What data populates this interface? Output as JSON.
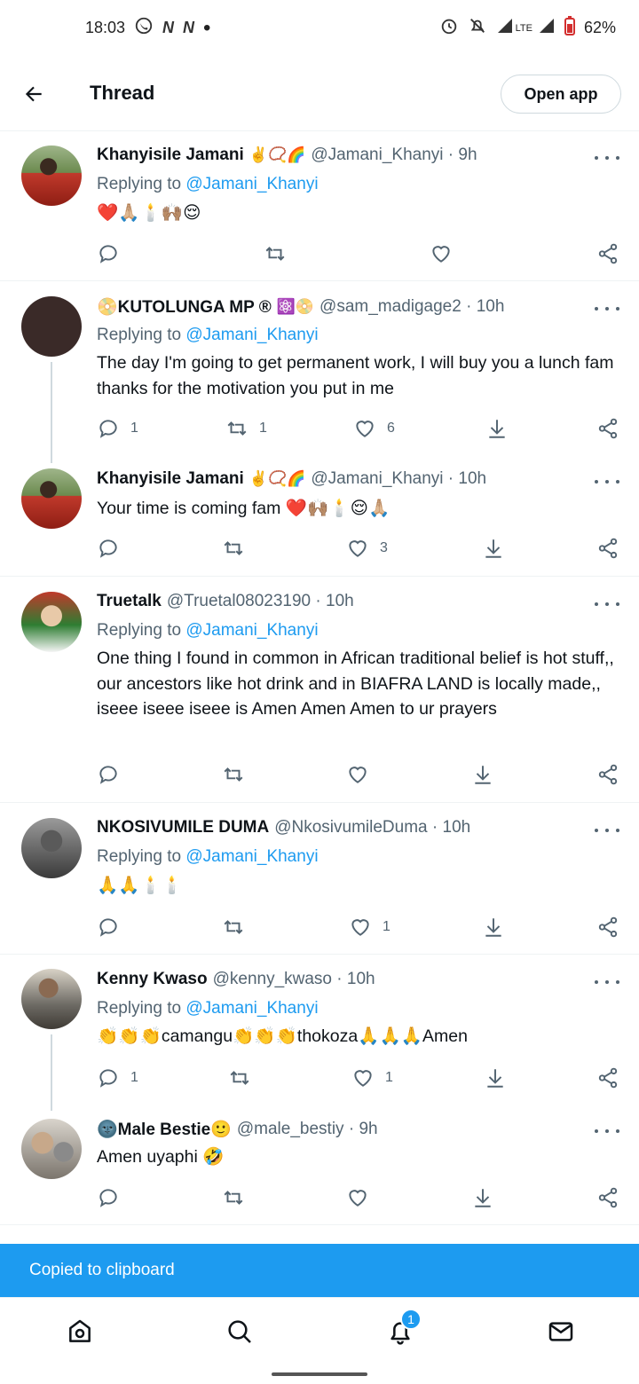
{
  "status_bar": {
    "time": "18:03",
    "battery": "62%",
    "network": "LTE",
    "left_icons": [
      "whatsapp-icon",
      "n-icon",
      "n-icon",
      "dot-icon"
    ],
    "right_icons": [
      "alarm-icon",
      "mute-icon",
      "signal-icon",
      "signal-icon",
      "battery-icon"
    ]
  },
  "header": {
    "title": "Thread",
    "open_app_label": "Open app"
  },
  "tweets": [
    {
      "name": "Khanyisile Jamani",
      "badges": "✌️📿🌈",
      "handle": "@Jamani_Khanyi",
      "time": "9h",
      "replying_prefix": "Replying to ",
      "replying_to": "@Jamani_Khanyi",
      "text": "❤️🙏🏼🕯️🙌🏽😌",
      "counts": {
        "replies": "",
        "retweets": "",
        "likes": ""
      }
    },
    {
      "name": "📀KUTOLUNGA MP ®",
      "badges": "⚛️📀",
      "handle": "@sam_madigage2",
      "time": "10h",
      "replying_prefix": "Replying to ",
      "replying_to": "@Jamani_Khanyi",
      "text": "The day I'm going to get permanent work, I will buy you a lunch fam thanks for the motivation you put in me",
      "counts": {
        "replies": "1",
        "retweets": "1",
        "likes": "6"
      }
    },
    {
      "name": "Khanyisile Jamani",
      "badges": "✌️📿🌈",
      "handle": "@Jamani_Khanyi",
      "time": "10h",
      "text": "Your time is coming fam ❤️🙌🏽🕯️😌🙏🏼",
      "counts": {
        "replies": "",
        "retweets": "",
        "likes": "3"
      }
    },
    {
      "name": "Truetalk",
      "badges": "",
      "handle": "@Truetal08023190",
      "time": "10h",
      "replying_prefix": "Replying to ",
      "replying_to": "@Jamani_Khanyi",
      "text": "One thing I found in common in African traditional belief is hot stuff,, our ancestors like hot drink and in BIAFRA LAND is locally made,, iseee iseee iseee is Amen Amen Amen to ur prayers",
      "counts": {
        "replies": "",
        "retweets": "",
        "likes": ""
      }
    },
    {
      "name": "NKOSIVUMILE DUMA",
      "badges": "",
      "handle": "@NkosivumileDuma",
      "time": "10h",
      "replying_prefix": "Replying to ",
      "replying_to": "@Jamani_Khanyi",
      "text": "🙏🙏🕯️🕯️",
      "counts": {
        "replies": "",
        "retweets": "",
        "likes": "1"
      }
    },
    {
      "name": "Kenny Kwaso",
      "badges": "",
      "handle": "@kenny_kwaso",
      "time": "10h",
      "replying_prefix": "Replying to ",
      "replying_to": "@Jamani_Khanyi",
      "text": "👏👏👏camangu👏👏👏thokoza🙏🙏🙏Amen",
      "counts": {
        "replies": "1",
        "retweets": "",
        "likes": "1"
      }
    },
    {
      "name": "🌚Male Bestie🙂",
      "badges": "",
      "handle": "@male_bestiy",
      "time": "9h",
      "text": "Amen uyaphi 🤣",
      "counts": {
        "replies": "",
        "retweets": "",
        "likes": ""
      }
    }
  ],
  "toast": "Copied to clipboard",
  "bottom_nav": {
    "items": [
      "home-icon",
      "search-icon",
      "notifications-icon",
      "messages-icon"
    ],
    "notification_count": "1"
  },
  "colors": {
    "accent": "#1d9bf0",
    "text_primary": "#0f1419",
    "text_secondary": "#536471",
    "divider": "#eff3f4"
  }
}
